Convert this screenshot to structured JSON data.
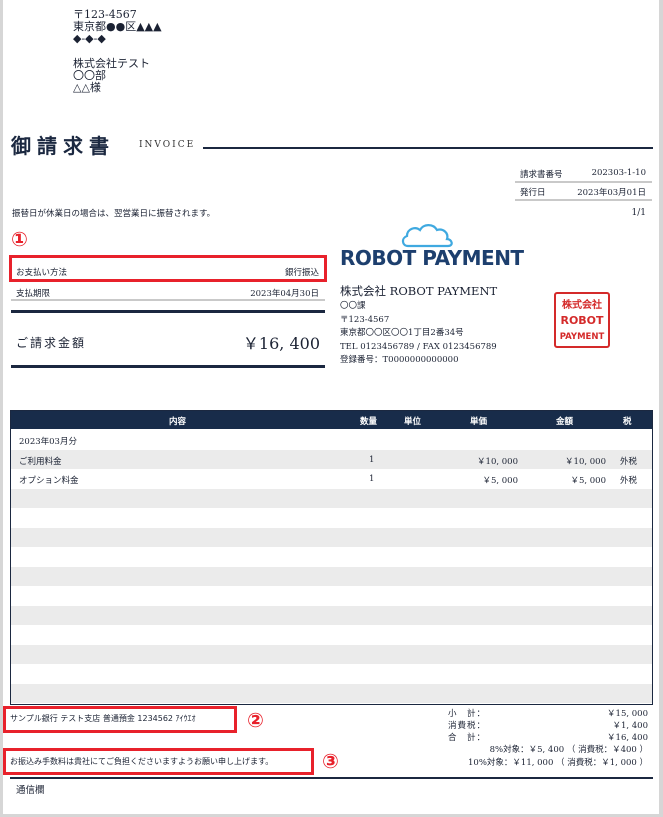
{
  "sender": {
    "postal": "〒123-4567",
    "address1": "東京都●●区▲▲▲",
    "address2": "◆-◆-◆"
  },
  "recipient": {
    "company": "株式会社テスト",
    "department": "〇〇部",
    "person": "△△様"
  },
  "header": {
    "title": "御請求書",
    "subtitle": "INVOICE"
  },
  "meta": {
    "invoice_no_label": "請求書番号",
    "invoice_no": "202303-1-10",
    "issue_date_label": "発行日",
    "issue_date": "2023年03月01日",
    "page": "1/1"
  },
  "notice": "振替日が休業日の場合は、翌営業日に振替されます。",
  "payment": {
    "method_label": "お支払い方法",
    "method": "銀行振込",
    "due_label": "支払期限",
    "due": "2023年04月30日",
    "total_label": "ご請求金額",
    "total": "￥16, 400"
  },
  "callouts": [
    "①",
    "②",
    "③"
  ],
  "logo": {
    "text": "ROBOT PAYMENT"
  },
  "issuer": {
    "name": "株式会社 ROBOT PAYMENT",
    "department": "〇〇課",
    "postal": "〒123-4567",
    "address": "東京都〇〇区〇〇1丁目2番34号",
    "tel_fax": "TEL 0123456789 / FAX 0123456789",
    "registration": "登録番号：T0000000000000"
  },
  "seal": {
    "lines": [
      "株式会社",
      "ROBOT",
      "PAYMENT"
    ]
  },
  "items": {
    "headers": [
      "内容",
      "数量",
      "単位",
      "単価",
      "金額",
      "税"
    ],
    "rows": [
      {
        "description": "2023年03月分",
        "qty": "",
        "unit": "",
        "unit_price": "",
        "amount": "",
        "tax": ""
      },
      {
        "description": "ご利用料金",
        "qty": "1",
        "unit": "",
        "unit_price": "￥10, 000",
        "amount": "￥10, 000",
        "tax": "外税"
      },
      {
        "description": "オプション料金",
        "qty": "1",
        "unit": "",
        "unit_price": "￥5, 000",
        "amount": "￥5, 000",
        "tax": "外税"
      }
    ]
  },
  "bank_info": "サンプル銀行 テスト支店 普通預金 1234562 ｱｲｳｴｵ",
  "fee_note": "お振込み手数料は貴社にてご負担くださいますようお願い申し上げます。",
  "summary": {
    "subtotal_label": "小　計：",
    "subtotal": "￥15, 000",
    "tax_label": "消費税：",
    "tax": "￥1, 400",
    "total_label": "合　計：",
    "total": "￥16, 400",
    "tax8": "8%対象：￥5, 400 （ 消費税：￥400 ）",
    "tax10": "10%対象：￥11, 000 （ 消費税：￥1, 000 ）"
  },
  "communication_label": "通信欄",
  "colors": {
    "navy": "#182c4a",
    "accent_red": "#e8212b",
    "logo_blue": "#1d3f6e",
    "row_gray": "#ebebeb"
  }
}
